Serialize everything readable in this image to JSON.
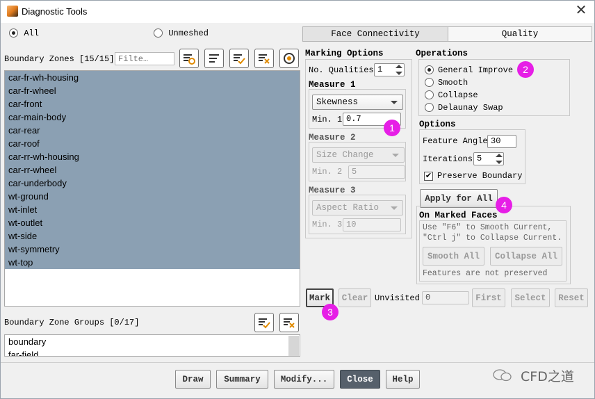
{
  "window": {
    "title": "Diagnostic Tools"
  },
  "scope": {
    "all_label": "All",
    "unmeshed_label": "Unmeshed",
    "selected": "All"
  },
  "boundary_zones": {
    "label": "Boundary Zones [15/15]",
    "filter_placeholder": "Filte…",
    "items": [
      "car-fr-wh-housing",
      "car-fr-wheel",
      "car-front",
      "car-main-body",
      "car-rear",
      "car-roof",
      "car-rr-wh-housing",
      "car-rr-wheel",
      "car-underbody",
      "wt-ground",
      "wt-inlet",
      "wt-outlet",
      "wt-side",
      "wt-symmetry",
      "wt-top"
    ]
  },
  "zone_groups": {
    "label": "Boundary Zone Groups [0/17]",
    "items": [
      "boundary",
      "far-field"
    ]
  },
  "tabs": [
    "Face Connectivity",
    "Quality"
  ],
  "active_tab": "Quality",
  "marking": {
    "title": "Marking Options",
    "no_qualities_label": "No. Qualities",
    "no_qualities_value": "1",
    "measure1": {
      "title": "Measure 1",
      "select": "Skewness",
      "min_label": "Min. 1",
      "min_value": "0.7"
    },
    "measure2": {
      "title": "Measure 2",
      "select": "Size Change",
      "min_label": "Min. 2",
      "min_value": "5"
    },
    "measure3": {
      "title": "Measure 3",
      "select": "Aspect Ratio",
      "min_label": "Min. 3",
      "min_value": "10"
    }
  },
  "operations": {
    "title": "Operations",
    "items": [
      "General Improve",
      "Smooth",
      "Collapse",
      "Delaunay Swap"
    ],
    "selected": "General Improve"
  },
  "options": {
    "title": "Options",
    "feature_angle_label": "Feature Angle",
    "feature_angle_value": "30",
    "iterations_label": "Iterations",
    "iterations_value": "5",
    "preserve_boundary_label": "Preserve Boundary",
    "preserve_boundary_checked": true
  },
  "apply_for_all": "Apply for All",
  "marked_faces": {
    "title": "On Marked Faces",
    "hint_line1": "Use \"F6\" to Smooth Current,",
    "hint_line2": "\"Ctrl j\" to Collapse Current.",
    "smooth_all": "Smooth All",
    "collapse_all": "Collapse All",
    "note": "Features are not preserved"
  },
  "bottom_row": {
    "mark": "Mark",
    "clear": "Clear",
    "unvisited_label": "Unvisited",
    "unvisited_value": "0",
    "first": "First",
    "select": "Select",
    "reset": "Reset"
  },
  "footer": {
    "draw": "Draw",
    "summary": "Summary",
    "modify": "Modify...",
    "close": "Close",
    "help": "Help"
  },
  "markers": [
    "1",
    "2",
    "3",
    "4"
  ],
  "watermark": "CFD之道"
}
